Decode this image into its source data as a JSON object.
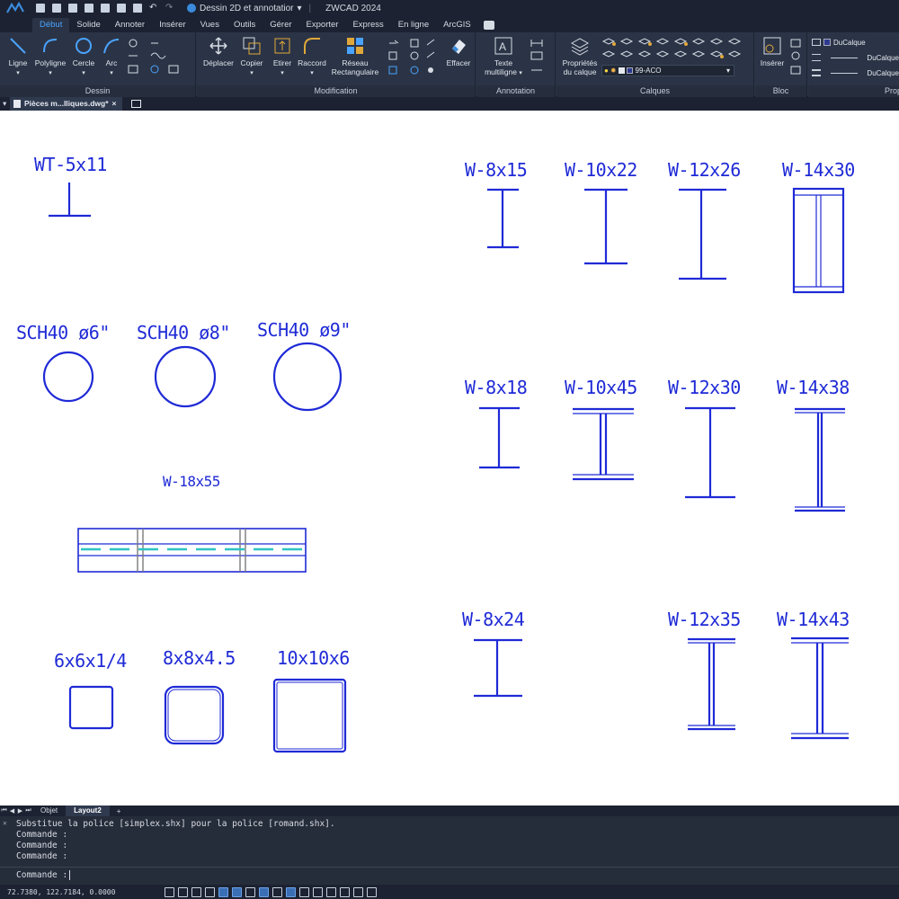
{
  "titlebar": {
    "workspace": "Dessin 2D et annotatior",
    "app_title": "ZWCAD 2024"
  },
  "ribbon_tabs": [
    "Début",
    "Solide",
    "Annoter",
    "Insérer",
    "Vues",
    "Outils",
    "Gérer",
    "Exporter",
    "Express",
    "En ligne",
    "ArcGIS"
  ],
  "ribbon": {
    "dessin": {
      "title": "Dessin",
      "ligne": "Ligne",
      "polyligne": "Polyligne",
      "cercle": "Cercle",
      "arc": "Arc"
    },
    "modification": {
      "title": "Modification",
      "deplacer": "Déplacer",
      "copier": "Copier",
      "etirer": "Etirer",
      "raccord": "Raccord",
      "reseau": "Réseau Rectangulaire",
      "effacer": "Effacer"
    },
    "annotation": {
      "title": "Annotation",
      "texte": "Texte multiligne"
    },
    "calques": {
      "title": "Calques",
      "proprietes": "Propriétés du calque",
      "current_layer": "99-ACO"
    },
    "bloc": {
      "title": "Bloc",
      "inserer": "Insérer"
    },
    "proprietes": {
      "title": "Prop",
      "color": "DuCalque",
      "linetype": "DuCalque",
      "lineweight": "DuCalque"
    }
  },
  "document_tab": "Pièces m...lliques.dwg*",
  "drawing": {
    "labels": {
      "wt": "WT-5x11",
      "w8x15": "W-8x15",
      "w10x22": "W-10x22",
      "w12x26": "W-12x26",
      "w14x30": "W-14x30",
      "sch6": "SCH40 ø6\"",
      "sch8": "SCH40 ø8\"",
      "sch9": "SCH40 ø9\"",
      "w8x18": "W-8x18",
      "w10x45": "W-10x45",
      "w12x30": "W-12x30",
      "w14x38": "W-14x38",
      "w18x55": "W-18x55",
      "w8x24": "W-8x24",
      "w12x35": "W-12x35",
      "w14x43": "W-14x43",
      "hss6": "6x6x1/4",
      "hss8": "8x8x4.5",
      "hss10": "10x10x6"
    },
    "colors": {
      "entity": "#1f2ad6",
      "center": "#2ec4c4",
      "section": "#8a8a8a"
    }
  },
  "layout_tabs": [
    "Objet",
    "Layout2"
  ],
  "command": {
    "history": [
      "Substitue la police [simplex.shx] pour la police [romand.shx].",
      "Commande :",
      "Commande :",
      "Commande :"
    ],
    "prompt": "Commande :"
  },
  "status": {
    "coords": "72.7380, 122.7184, 0.0000"
  }
}
